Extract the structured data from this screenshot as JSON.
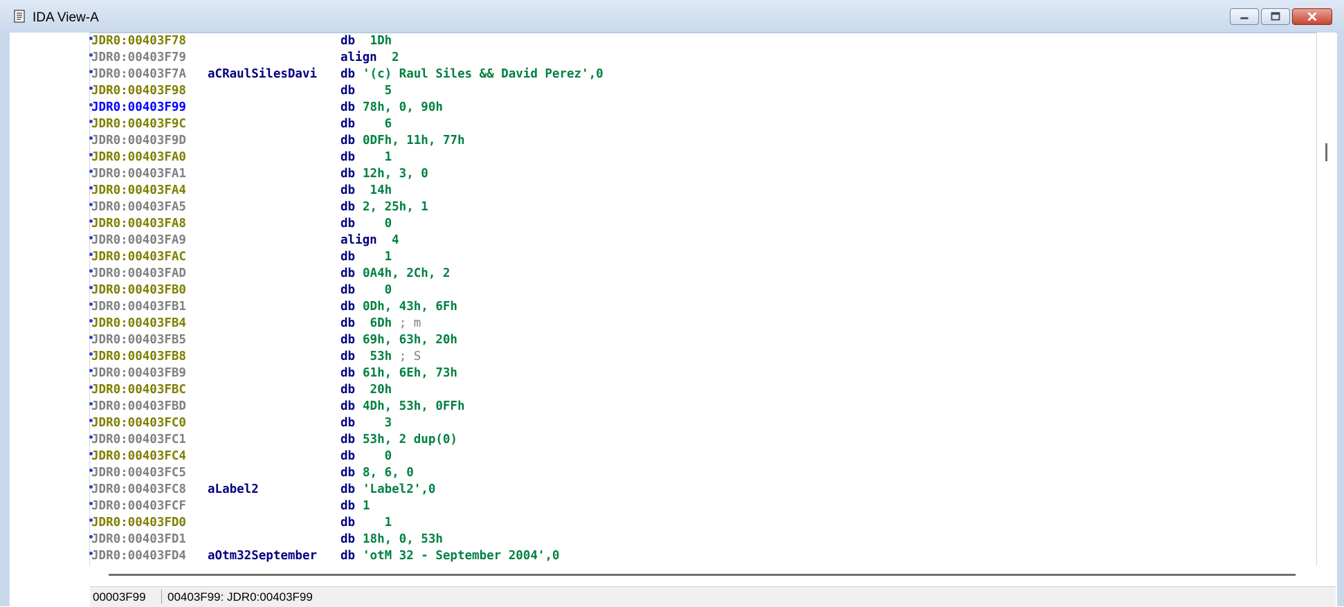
{
  "window": {
    "title": "IDA View-A",
    "icon": "document-icon",
    "controls": [
      "minimize-icon",
      "restore-icon",
      "close-icon"
    ]
  },
  "listing": [
    {
      "addr": "JDR0:00403F78",
      "label": "",
      "mn": "db",
      "op": " 1Dh",
      "cmt": "",
      "kind": "data"
    },
    {
      "addr": "JDR0:00403F79",
      "label": "",
      "mn": "align",
      "op": "2",
      "cmt": "",
      "kind": "code"
    },
    {
      "addr": "JDR0:00403F7A",
      "label": "aCRaulSilesDavi",
      "mn": "db",
      "op": "'(c) Raul Siles && David Perez',0",
      "cmt": "",
      "kind": "code"
    },
    {
      "addr": "JDR0:00403F98",
      "label": "",
      "mn": "db",
      "op": "   5",
      "cmt": "",
      "kind": "data"
    },
    {
      "addr": "JDR0:00403F99",
      "label": "",
      "mn": "db",
      "op": "78h, 0, 90h",
      "cmt": "",
      "kind": "cur"
    },
    {
      "addr": "JDR0:00403F9C",
      "label": "",
      "mn": "db",
      "op": "   6",
      "cmt": "",
      "kind": "data"
    },
    {
      "addr": "JDR0:00403F9D",
      "label": "",
      "mn": "db",
      "op": "0DFh, 11h, 77h",
      "cmt": "",
      "kind": "code"
    },
    {
      "addr": "JDR0:00403FA0",
      "label": "",
      "mn": "db",
      "op": "   1",
      "cmt": "",
      "kind": "data"
    },
    {
      "addr": "JDR0:00403FA1",
      "label": "",
      "mn": "db",
      "op": "12h, 3, 0",
      "cmt": "",
      "kind": "code"
    },
    {
      "addr": "JDR0:00403FA4",
      "label": "",
      "mn": "db",
      "op": " 14h",
      "cmt": "",
      "kind": "data"
    },
    {
      "addr": "JDR0:00403FA5",
      "label": "",
      "mn": "db",
      "op": "2, 25h, 1",
      "cmt": "",
      "kind": "code"
    },
    {
      "addr": "JDR0:00403FA8",
      "label": "",
      "mn": "db",
      "op": "   0",
      "cmt": "",
      "kind": "data"
    },
    {
      "addr": "JDR0:00403FA9",
      "label": "",
      "mn": "align",
      "op": "4",
      "cmt": "",
      "kind": "code"
    },
    {
      "addr": "JDR0:00403FAC",
      "label": "",
      "mn": "db",
      "op": "   1",
      "cmt": "",
      "kind": "data"
    },
    {
      "addr": "JDR0:00403FAD",
      "label": "",
      "mn": "db",
      "op": "0A4h, 2Ch, 2",
      "cmt": "",
      "kind": "code"
    },
    {
      "addr": "JDR0:00403FB0",
      "label": "",
      "mn": "db",
      "op": "   0",
      "cmt": "",
      "kind": "data"
    },
    {
      "addr": "JDR0:00403FB1",
      "label": "",
      "mn": "db",
      "op": "0Dh, 43h, 6Fh",
      "cmt": "",
      "kind": "code"
    },
    {
      "addr": "JDR0:00403FB4",
      "label": "",
      "mn": "db",
      "op": " 6Dh",
      "cmt": " ; m",
      "kind": "data"
    },
    {
      "addr": "JDR0:00403FB5",
      "label": "",
      "mn": "db",
      "op": "69h, 63h, 20h",
      "cmt": "",
      "kind": "code"
    },
    {
      "addr": "JDR0:00403FB8",
      "label": "",
      "mn": "db",
      "op": " 53h",
      "cmt": " ; S",
      "kind": "data"
    },
    {
      "addr": "JDR0:00403FB9",
      "label": "",
      "mn": "db",
      "op": "61h, 6Eh, 73h",
      "cmt": "",
      "kind": "code"
    },
    {
      "addr": "JDR0:00403FBC",
      "label": "",
      "mn": "db",
      "op": " 20h",
      "cmt": "",
      "kind": "data"
    },
    {
      "addr": "JDR0:00403FBD",
      "label": "",
      "mn": "db",
      "op": "4Dh, 53h, 0FFh",
      "cmt": "",
      "kind": "code"
    },
    {
      "addr": "JDR0:00403FC0",
      "label": "",
      "mn": "db",
      "op": "   3",
      "cmt": "",
      "kind": "data"
    },
    {
      "addr": "JDR0:00403FC1",
      "label": "",
      "mn": "db",
      "op": "53h, 2 dup(0)",
      "cmt": "",
      "kind": "code"
    },
    {
      "addr": "JDR0:00403FC4",
      "label": "",
      "mn": "db",
      "op": "   0",
      "cmt": "",
      "kind": "data"
    },
    {
      "addr": "JDR0:00403FC5",
      "label": "",
      "mn": "db",
      "op": "8, 6, 0",
      "cmt": "",
      "kind": "code"
    },
    {
      "addr": "JDR0:00403FC8",
      "label": "aLabel2",
      "mn": "db",
      "op": "'Label2',0",
      "cmt": "",
      "kind": "code"
    },
    {
      "addr": "JDR0:00403FCF",
      "label": "",
      "mn": "db",
      "op": "1",
      "cmt": "",
      "kind": "code"
    },
    {
      "addr": "JDR0:00403FD0",
      "label": "",
      "mn": "db",
      "op": "   1",
      "cmt": "",
      "kind": "data"
    },
    {
      "addr": "JDR0:00403FD1",
      "label": "",
      "mn": "db",
      "op": "18h, 0, 53h",
      "cmt": "",
      "kind": "code"
    },
    {
      "addr": "JDR0:00403FD4",
      "label": "aOtm32September",
      "mn": "db",
      "op": "'otM 32 - September 2004',0",
      "cmt": "",
      "kind": "code"
    }
  ],
  "status": {
    "offset": "00003F99",
    "location": "00403F99: JDR0:00403F99"
  }
}
